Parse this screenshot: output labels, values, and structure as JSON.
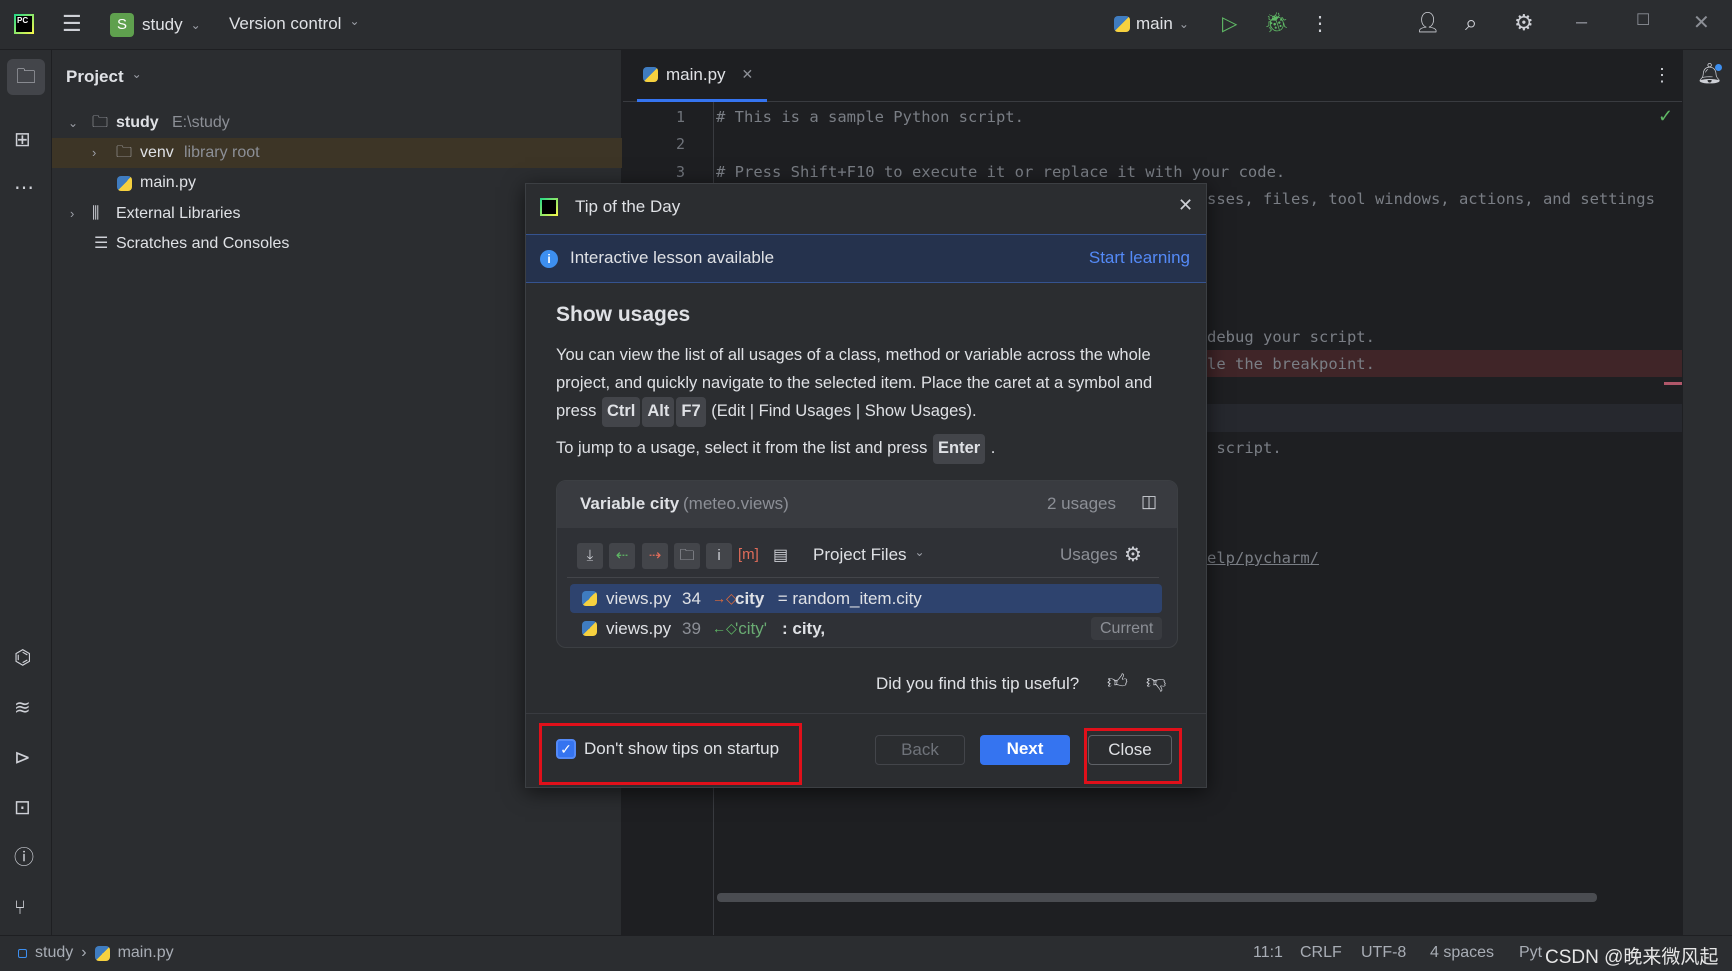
{
  "titlebar": {
    "project_badge": "S",
    "project_name": "study",
    "vcs_label": "Version control",
    "run_config": "main"
  },
  "project_panel": {
    "title": "Project",
    "tree": [
      {
        "label": "study",
        "hint": "E:\\study"
      },
      {
        "label": "venv",
        "hint": "library root"
      },
      {
        "label": "main.py",
        "hint": ""
      },
      {
        "label": "External Libraries",
        "hint": ""
      },
      {
        "label": "Scratches and Consoles",
        "hint": ""
      }
    ]
  },
  "editor": {
    "tab": "main.py",
    "line_numbers": [
      "1",
      "2",
      "3"
    ],
    "lines": {
      "l1": "# This is a sample Python script.",
      "l3": "# Press Shift+F10 to execute it or replace it with your code.",
      "l4_fragment": "sses, files, tool windows, actions, and settings",
      "debug_fragment": "debug your script.",
      "breakpoint_fragment": "le the breakpoint.",
      "script_fragment": " script.",
      "link_fragment": "elp/pycharm/"
    }
  },
  "dialog": {
    "title": "Tip of the Day",
    "banner_text": "Interactive lesson available",
    "banner_link": "Start learning",
    "heading": "Show usages",
    "para1_a": "You can view the list of all usages of a class, method or variable across the whole project, and quickly navigate to the selected item. Place the caret at a symbol and press",
    "keys": [
      "Ctrl",
      "Alt",
      "F7"
    ],
    "para1_b": "(Edit | Find Usages | Show Usages).",
    "para2": "To jump to a usage, select it from the list and press",
    "para2_key": "Enter",
    "usage_box": {
      "title_bold": "Variable city",
      "title_scope": "(meteo.views)",
      "count": "2 usages",
      "scope_select": "Project Files",
      "usages_label": "Usages",
      "rows": [
        {
          "file": "views.py",
          "line": "34",
          "code_bold": "city",
          "code_rest": " = random_item.city",
          "badge": ""
        },
        {
          "file": "views.py",
          "line": "39",
          "code_string": "'city'",
          "code_rest": ": city,",
          "badge": "Current"
        }
      ]
    },
    "feedback": "Did you find this tip useful?",
    "checkbox_label": "Don't show tips on startup",
    "checkbox_checked": true,
    "back": "Back",
    "next": "Next",
    "close": "Close"
  },
  "statusbar": {
    "breadcrumb": [
      "study",
      "main.py"
    ],
    "position": "11:1",
    "line_sep": "CRLF",
    "encoding": "UTF-8",
    "indent": "4 spaces",
    "interpreter": "Pyt",
    "watermark": "CSDN @晚来微风起"
  },
  "colors": {
    "accent": "#3574f0",
    "highlight_box": "#e0101a",
    "selection": "#2e436e"
  }
}
